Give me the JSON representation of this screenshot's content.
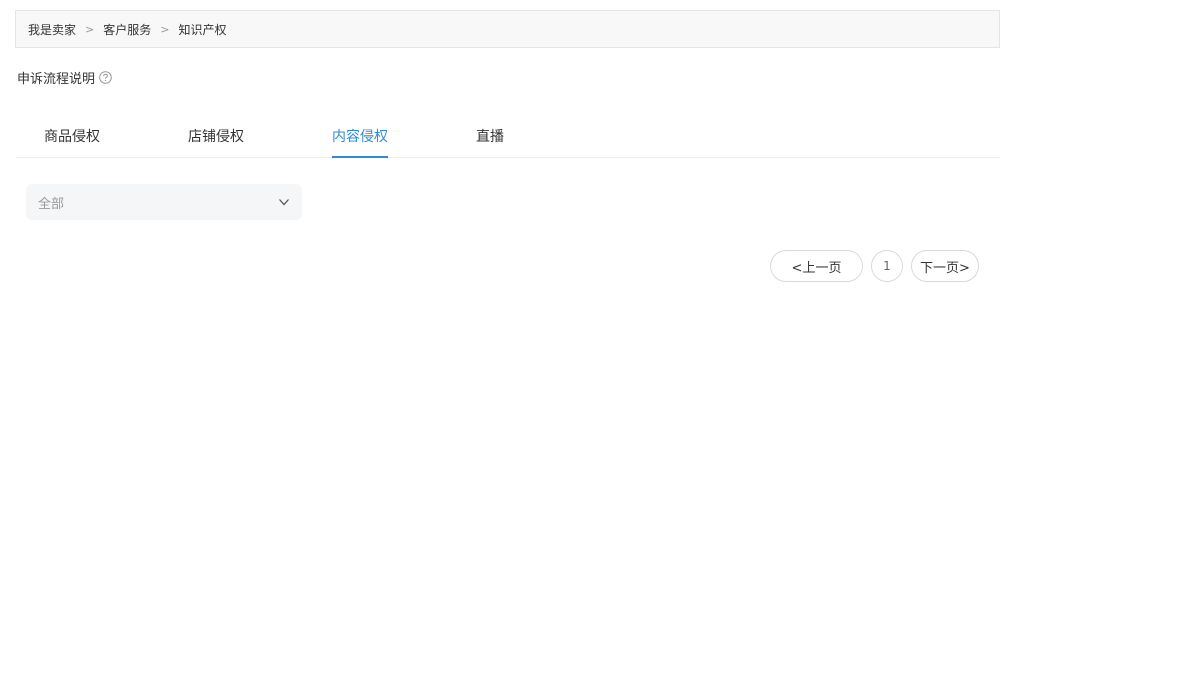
{
  "breadcrumb": {
    "items": [
      "我是卖家",
      "客户服务",
      "知识产权"
    ],
    "separator": ">"
  },
  "appeal": {
    "label": "申诉流程说明",
    "icon": "question-circle-icon"
  },
  "tabs": [
    {
      "label": "商品侵权",
      "active": false
    },
    {
      "label": "店铺侵权",
      "active": false
    },
    {
      "label": "内容侵权",
      "active": true
    },
    {
      "label": "直播",
      "active": false
    }
  ],
  "filter": {
    "value": "全部",
    "icon": "chevron-down-icon"
  },
  "pagination": {
    "prev_label": "<上一页",
    "current_page": "1",
    "next_label": "下一页>"
  },
  "colors": {
    "accent": "#3089dc",
    "text": "#333333",
    "muted": "#999999",
    "border": "#e5e5e5"
  }
}
